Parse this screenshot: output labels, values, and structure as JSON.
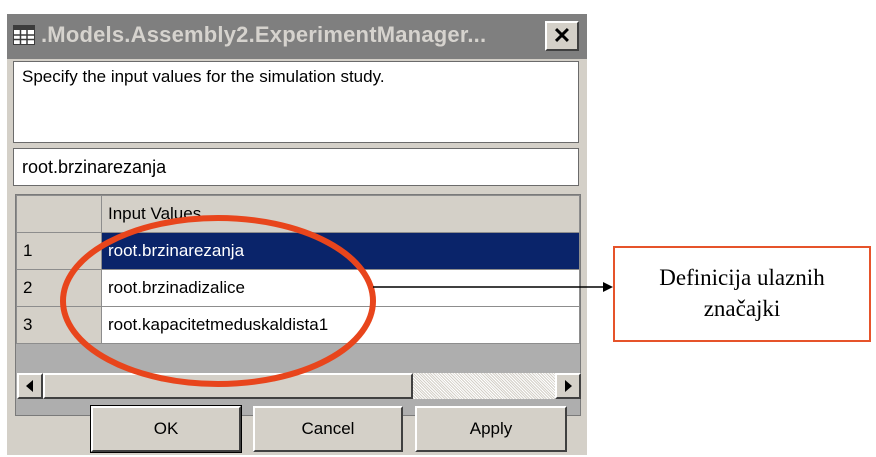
{
  "window": {
    "title": ".Models.Assembly2.ExperimentManager...",
    "close_glyph": "✕"
  },
  "description": "Specify the input values for the simulation study.",
  "selected_input": "root.brzinarezanja",
  "grid": {
    "header": "Input Values",
    "rows": [
      {
        "num": "1",
        "value": "root.brzinarezanja",
        "selected": true
      },
      {
        "num": "2",
        "value": "root.brzinadizalice",
        "selected": false
      },
      {
        "num": "3",
        "value": "root.kapacitetmeduskaldista1",
        "selected": false
      }
    ]
  },
  "buttons": {
    "ok": "OK",
    "cancel": "Cancel",
    "apply": "Apply"
  },
  "annotation": {
    "line1": "Definicija ulaznih",
    "line2": "značajki",
    "ellipse_color": "#e8451c",
    "box_color": "#e6532a"
  },
  "colors": {
    "selection": "#0a246a",
    "dialog_bg": "#d4d0c8",
    "titlebar_bg": "#7f7f7f"
  },
  "icons": [
    "table-icon",
    "close-icon",
    "scroll-left-icon",
    "scroll-right-icon"
  ]
}
